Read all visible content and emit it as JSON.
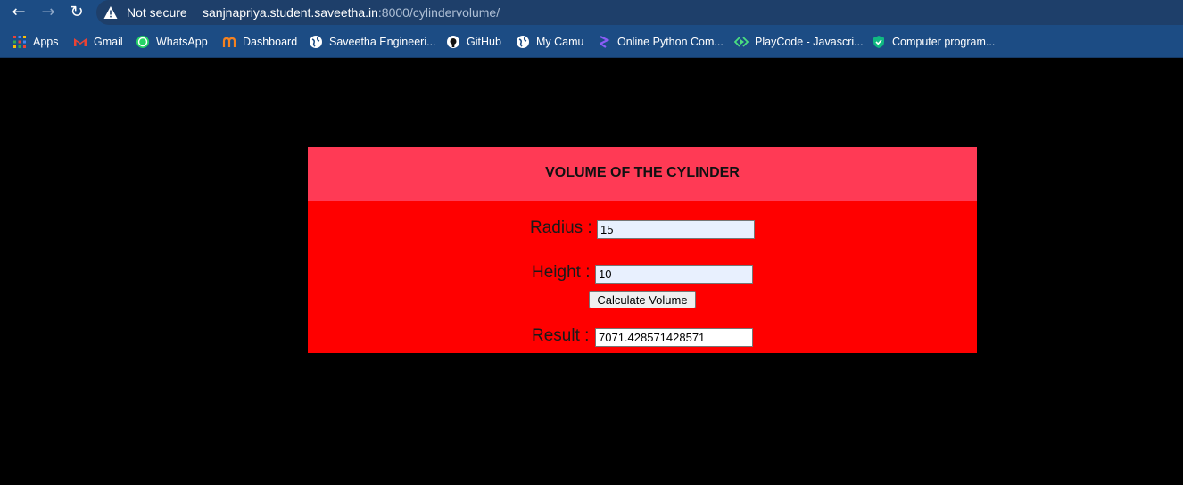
{
  "browser": {
    "security_label": "Not secure",
    "url_host": "sanjnapriya.student.saveetha.in",
    "url_path": ":8000/cylindervolume/"
  },
  "bookmarks": [
    {
      "label": "Apps",
      "icon": "apps-grid-icon"
    },
    {
      "label": "Gmail",
      "icon": "gmail-icon"
    },
    {
      "label": "WhatsApp",
      "icon": "whatsapp-icon"
    },
    {
      "label": "Dashboard",
      "icon": "dashboard-icon"
    },
    {
      "label": "Saveetha Engineeri...",
      "icon": "globe-icon"
    },
    {
      "label": "GitHub",
      "icon": "github-icon"
    },
    {
      "label": "My Camu",
      "icon": "globe-icon"
    },
    {
      "label": "Online Python Com...",
      "icon": "python-compiler-icon"
    },
    {
      "label": "PlayCode - Javascri...",
      "icon": "playcode-icon"
    },
    {
      "label": "Computer program...",
      "icon": "shield-icon"
    }
  ],
  "form": {
    "title": "VOLUME OF THE CYLINDER",
    "radius_label": "Radius :",
    "radius_value": "15",
    "height_label": "Height :",
    "height_value": "10",
    "calculate_label": "Calculate Volume",
    "result_label": "Result :",
    "result_value": "7071.428571428571"
  },
  "colors": {
    "header_bg": "#ff3a55",
    "body_bg": "#ff0000",
    "page_bg": "#000000",
    "chrome_bg": "#1c4c84"
  }
}
